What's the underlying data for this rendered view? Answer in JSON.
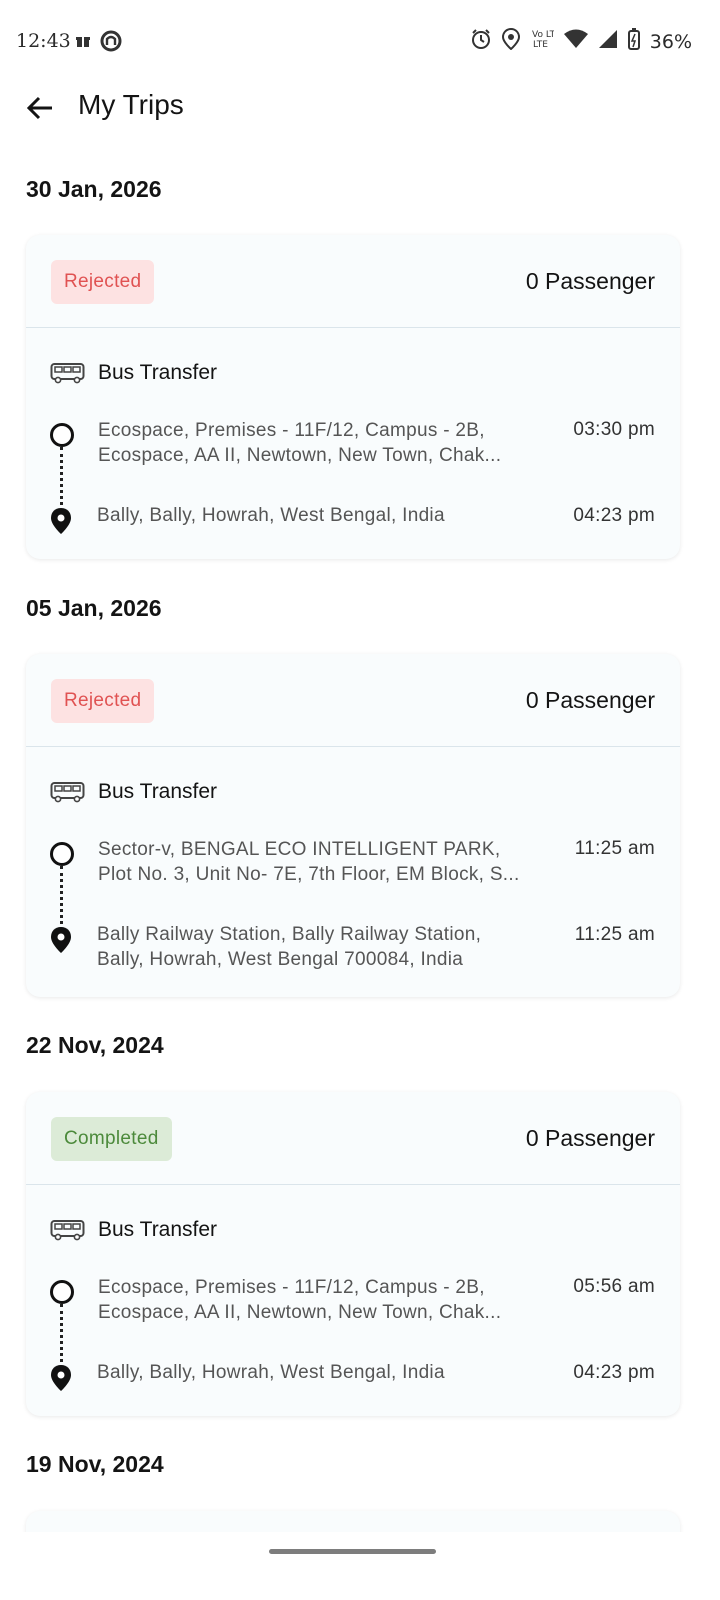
{
  "status_bar": {
    "time": "12:43",
    "left_icons": [
      "gift-icon",
      "app-notification-icon"
    ],
    "right_icons": [
      "alarm-icon",
      "location-icon",
      "volte-icon",
      "wifi-icon",
      "signal-icon",
      "battery-icon"
    ],
    "volte_text": "Vo LTE",
    "battery": "36%"
  },
  "app_bar": {
    "title": "My Trips"
  },
  "trips": [
    {
      "date": "30 Jan, 2026",
      "status": "Rejected",
      "passengers": "0 Passenger",
      "transfer_type": "Bus Transfer",
      "pickup_address": "Ecospace, Premises - 11F/12, Campus - 2B,",
      "pickup_address_2": "Ecospace, AA II, Newtown, New Town, Chak...",
      "pickup_time": "03:30 pm",
      "drop_address": "Bally, Bally, Howrah, West Bengal, India",
      "drop_address_2": "",
      "drop_time": "04:23 pm"
    },
    {
      "date": "05 Jan, 2026",
      "status": "Rejected",
      "passengers": "0 Passenger",
      "transfer_type": "Bus Transfer",
      "pickup_address": "Sector-v, BENGAL ECO INTELLIGENT PARK,",
      "pickup_address_2": "Plot No. 3, Unit No- 7E, 7th Floor, EM Block, S...",
      "pickup_time": "11:25 am",
      "drop_address": "Bally Railway Station, Bally Railway Station,",
      "drop_address_2": "Bally, Howrah, West Bengal 700084, India",
      "drop_time": "11:25 am"
    },
    {
      "date": "22 Nov, 2024",
      "status": "Completed",
      "passengers": "0 Passenger",
      "transfer_type": "Bus Transfer",
      "pickup_address": "Ecospace, Premises - 11F/12, Campus - 2B,",
      "pickup_address_2": "Ecospace, AA II, Newtown, New Town, Chak...",
      "pickup_time": "05:56 am",
      "drop_address": "Bally, Bally, Howrah, West Bengal, India",
      "drop_address_2": "",
      "drop_time": "04:23 pm"
    },
    {
      "date": "19 Nov, 2024"
    }
  ],
  "colors": {
    "rejected_bg": "#fde2e2",
    "rejected_text": "#e05252",
    "completed_bg": "#dcebd7",
    "completed_text": "#4c8a3b",
    "card_bg": "#f9fcfd"
  }
}
